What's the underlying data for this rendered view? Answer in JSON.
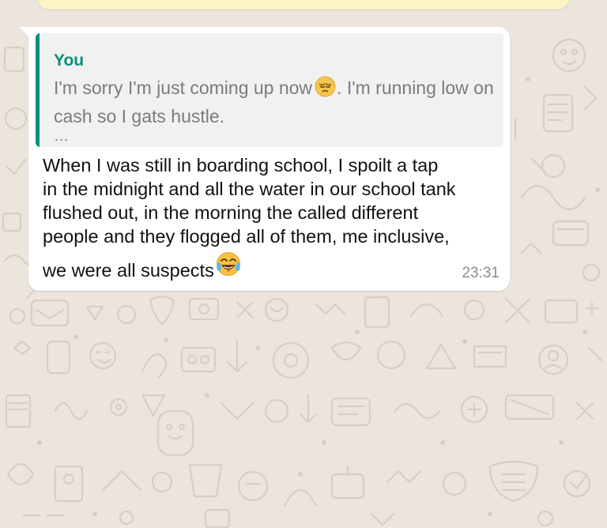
{
  "chat": {
    "wallpaper_color": "#ece5dd",
    "doodle_color": "#d5cec3",
    "quoted_message": {
      "author": "You",
      "author_color": "#06907a",
      "text_part1": "I'm sorry I'm just coming up now",
      "emoji": "pensive-face-emoji",
      "text_part2": ". I'm running low on cash so I gats hustle.",
      "ellipsis": "…"
    },
    "message": {
      "lines": [
        "When I was still in boarding school, I spoilt a tap",
        "in the midnight and all the water in our school tank",
        "flushed out, in the morning the called different",
        "people and they flogged all of them, me inclusive,",
        "we were all suspects"
      ],
      "trailing_emoji": "tears-of-joy-emoji",
      "time": "23:31"
    }
  }
}
